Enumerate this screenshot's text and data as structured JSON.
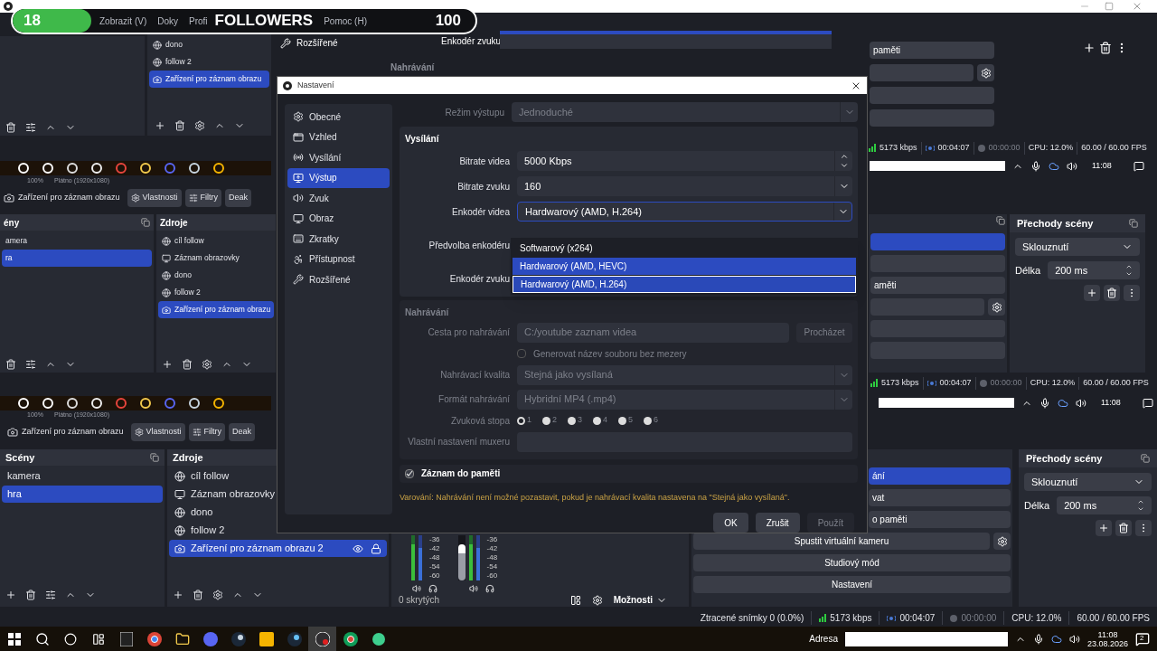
{
  "overlay": {
    "count": "18",
    "label": "FOLLOWERS",
    "goal": "100",
    "level": 0.17
  },
  "capture_menu": [
    "Zobrazit (V)",
    "Doky",
    "Profi",
    "Pomoc (H)"
  ],
  "capture_top": {
    "sources": [
      {
        "name": "dono",
        "kind": "browser",
        "selected": false
      },
      {
        "name": "follow 2",
        "kind": "browser",
        "selected": false
      },
      {
        "name": "Zařízení pro záznam obrazu",
        "kind": "camera",
        "selected": true
      }
    ],
    "settings_item": "Rozšířené",
    "field_label": "Enkodér zvuku",
    "section": "Nahrávání",
    "controls": [
      {
        "kind": "button",
        "label": "paměti"
      },
      {
        "kind": "gear"
      },
      {
        "kind": "blank"
      },
      {
        "kind": "blank"
      }
    ],
    "status": {
      "kbps": "5173 kbps",
      "stream": "00:04:07",
      "rec": "00:00:00",
      "cpu": "CPU: 12.0%",
      "fps": "60.00 / 60.00 FPS"
    },
    "clock": "11:08",
    "zoom": "100%",
    "canvas": "Plátno (1920x1080)"
  },
  "capture_mid": {
    "context": {
      "source": "Zařízení pro záznam obrazu",
      "buttons": [
        "Vlastnosti",
        "Filtry",
        "Deak"
      ]
    },
    "scenes": {
      "title": "ény",
      "items": [
        {
          "name": "amera",
          "selected": false
        },
        {
          "name": "ra",
          "selected": true
        }
      ]
    },
    "sources": {
      "title": "Zdroje",
      "items": [
        {
          "name": "cíl follow",
          "kind": "browser",
          "selected": false
        },
        {
          "name": "Záznam obrazovky",
          "kind": "display",
          "selected": false
        },
        {
          "name": "dono",
          "kind": "browser",
          "selected": false
        },
        {
          "name": "follow 2",
          "kind": "browser",
          "selected": false
        },
        {
          "name": "Zařízení pro záznam obrazu",
          "kind": "camera",
          "selected": true
        }
      ]
    },
    "controls": [
      {
        "kind": "blank",
        "selected": true
      },
      {
        "kind": "blank",
        "selected": false
      },
      {
        "kind": "button",
        "label": "aměti",
        "selected": false
      },
      {
        "kind": "gear",
        "selected": false
      },
      {
        "kind": "blank",
        "selected": false
      },
      {
        "kind": "blank",
        "selected": false
      }
    ],
    "transitions": {
      "title": "Přechody scény",
      "type": "Sklouznutí",
      "duration_label": "Délka",
      "duration": "200 ms"
    },
    "status": {
      "kbps": "5173 kbps",
      "stream": "00:04:07",
      "rec": "00:00:00",
      "cpu": "CPU: 12.0%",
      "fps": "60.00 / 60.00 FPS"
    },
    "clock": "11:08",
    "zoom": "100%",
    "canvas": "Plátno (1920x1080)"
  },
  "context": {
    "source": "Zařízení pro záznam obrazu",
    "buttons": [
      "Vlastnosti",
      "Filtry",
      "Deak"
    ]
  },
  "dialog": {
    "title": "Nastavení",
    "nav": [
      {
        "label": "Obecné",
        "selected": false
      },
      {
        "label": "Vzhled",
        "selected": false
      },
      {
        "label": "Vysílání",
        "selected": false
      },
      {
        "label": "Výstup",
        "selected": true
      },
      {
        "label": "Zvuk",
        "selected": false
      },
      {
        "label": "Obraz",
        "selected": false
      },
      {
        "label": "Zkratky",
        "selected": false
      },
      {
        "label": "Přístupnost",
        "selected": false
      },
      {
        "label": "Rozšířené",
        "selected": false
      }
    ],
    "mode": {
      "label": "Režim výstupu",
      "value": "Jednoduché",
      "disabled": true
    },
    "stream": {
      "title": "Vysílání",
      "fields": [
        {
          "kind": "spin",
          "label": "Bitrate videa",
          "value": "5000 Kbps"
        },
        {
          "kind": "select",
          "label": "Bitrate zvuku",
          "value": "160"
        },
        {
          "kind": "open",
          "label": "Enkodér videa",
          "value": "Hardwarový (AMD, H.264)"
        },
        {
          "kind": "covered",
          "label": "Předvolba enkodéru"
        },
        {
          "kind": "covered",
          "label": "Enkodér zvuku"
        }
      ]
    },
    "dropdown": [
      {
        "label": "Softwarový (x264)",
        "hovered": false,
        "selected": false
      },
      {
        "label": "Hardwarový (AMD, HEVC)",
        "hovered": true,
        "selected": false
      },
      {
        "label": "Hardwarový (AMD, H.264)",
        "hovered": false,
        "selected": true
      }
    ],
    "recording": {
      "title": "Nahrávání",
      "disabled": true,
      "path_label": "Cesta pro nahrávání",
      "path": "C:/youtube zaznam videa",
      "browse": "Procházet",
      "checkbox": {
        "label": "Generovat název souboru bez mezery",
        "checked": false
      },
      "quality": {
        "label": "Nahrávací kvalita",
        "value": "Stejná jako vysílaná"
      },
      "format": {
        "label": "Formát nahrávání",
        "value": "Hybridní MP4 (.mp4)"
      },
      "tracks_label": "Zvuková stopa",
      "tracks": [
        {
          "label": "1",
          "selected": true
        },
        {
          "label": "2",
          "selected": false
        },
        {
          "label": "3",
          "selected": false
        },
        {
          "label": "4",
          "selected": false
        },
        {
          "label": "5",
          "selected": false
        },
        {
          "label": "6",
          "selected": false
        }
      ],
      "muxer_label": "Vlastní nastavení muxeru"
    },
    "replay": {
      "label": "Záznam do paměti",
      "checked": true
    },
    "warning": "Varování: Nahrávání není možné pozastavit, pokud je nahrávací kvalita nastavena na \"Stejná jako vysílaná\".",
    "buttons": [
      {
        "label": "OK",
        "disabled": false
      },
      {
        "label": "Zrušit",
        "disabled": false
      },
      {
        "label": "Použít",
        "disabled": true
      }
    ]
  },
  "scenes": {
    "title": "Scény",
    "items": [
      {
        "name": "kamera",
        "selected": false
      },
      {
        "name": "hra",
        "selected": true
      }
    ]
  },
  "sources": {
    "title": "Zdroje",
    "items": [
      {
        "name": "cíl follow",
        "kind": "browser",
        "selected": false
      },
      {
        "name": "Záznam obrazovky",
        "kind": "display",
        "selected": false
      },
      {
        "name": "dono",
        "kind": "browser",
        "selected": false
      },
      {
        "name": "follow 2",
        "kind": "browser",
        "selected": false
      },
      {
        "name": "Zařízení pro záznam obrazu 2",
        "kind": "camera",
        "selected": true
      }
    ]
  },
  "mixer": {
    "channels": [
      {
        "scale": [
          "-36",
          "-42",
          "-48",
          "-54",
          "-60"
        ]
      },
      {
        "scale": [
          "-36",
          "-42",
          "-48",
          "-54",
          "-60"
        ],
        "level": 0.8
      }
    ],
    "hidden": "0 skrytých",
    "options": "Možnosti"
  },
  "controls": [
    {
      "kind": "cut",
      "label": "ání",
      "selected": true
    },
    {
      "kind": "cut",
      "label": "vat",
      "selected": false
    },
    {
      "kind": "cut",
      "label": "o paměti",
      "selected": false
    },
    {
      "kind": "gear",
      "label": "Spustit virtuální kameru",
      "selected": false
    },
    {
      "kind": "full",
      "label": "Studiový mód",
      "selected": false
    },
    {
      "kind": "full",
      "label": "Nastavení",
      "selected": false
    }
  ],
  "transitions": {
    "title": "Přechody scény",
    "type": "Sklouznutí",
    "duration_label": "Délka",
    "duration": "200 ms"
  },
  "status": {
    "dropped": "Ztracené snímky 0 (0.0%)",
    "kbps": "5173 kbps",
    "stream": "00:04:07",
    "rec": "00:00:00",
    "cpu": "CPU: 12.0%",
    "fps": "60.00 / 60.00 FPS"
  },
  "taskbar": {
    "address_label": "Adresa",
    "time": "11:08",
    "date": "23.08.2026",
    "notifications": "2"
  }
}
